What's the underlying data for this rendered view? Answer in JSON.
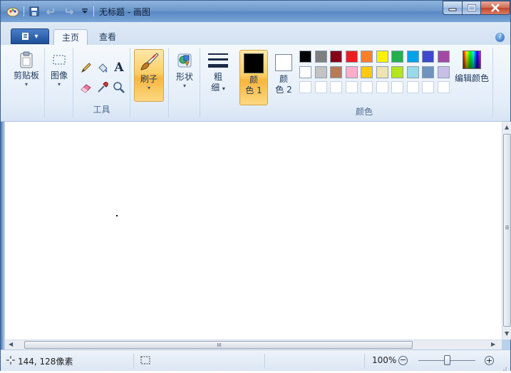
{
  "window": {
    "title": "无标题 - 画图"
  },
  "ribbon": {
    "tabs": [
      "主页",
      "查看"
    ],
    "groups": {
      "clipboard": {
        "label": "剪贴板"
      },
      "image": {
        "label": "图像"
      },
      "tools": {
        "label": "工具",
        "text_tool": "A"
      },
      "brushes": {
        "label": "刷子"
      },
      "shapes": {
        "label": "形状"
      },
      "size": {
        "label_line1": "粗",
        "label_line2": "细"
      },
      "color1": {
        "label_line1": "颜",
        "label_line2": "色 1"
      },
      "color2": {
        "label_line1": "颜",
        "label_line2": "色 2"
      },
      "colors": {
        "label": "颜色"
      },
      "edit_colors": {
        "label": "编辑颜色"
      }
    },
    "active_colors": {
      "color1": "#000000",
      "color2": "#ffffff"
    },
    "palette_row1": [
      "#000000",
      "#7f7f7f",
      "#880015",
      "#ed1c24",
      "#ff7f27",
      "#fff200",
      "#22b14c",
      "#00a2e8",
      "#3f48cc",
      "#a349a4"
    ],
    "palette_row2": [
      "#ffffff",
      "#c3c3c3",
      "#b97a57",
      "#ffaec9",
      "#ffc90e",
      "#efe4b0",
      "#b5e61d",
      "#99d9ea",
      "#7092be",
      "#c8bfe7"
    ]
  },
  "statusbar": {
    "cursor_position": "144, 128像素",
    "zoom_percent": "100%",
    "zoom_level": 1.0
  }
}
